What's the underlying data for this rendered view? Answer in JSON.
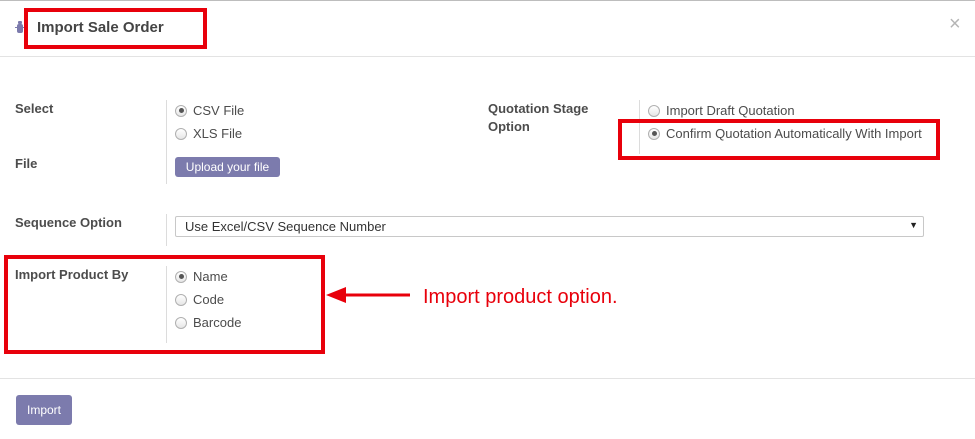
{
  "dialog": {
    "title": "Import Sale Order",
    "close_symbol": "×"
  },
  "form": {
    "select_file": {
      "label_line1": "Select",
      "label_line2": "File",
      "options": [
        {
          "label": "CSV File",
          "checked": true
        },
        {
          "label": "XLS File",
          "checked": false
        }
      ],
      "upload_label": "Upload your file"
    },
    "quotation_stage": {
      "label_line1": "Quotation Stage",
      "label_line2": "Option",
      "options": [
        {
          "label": "Import Draft Quotation",
          "checked": false
        },
        {
          "label": "Confirm Quotation Automatically With Import",
          "checked": true
        }
      ]
    },
    "sequence": {
      "label": "Sequence Option",
      "selected": "Use Excel/CSV Sequence Number",
      "caret": "▼"
    },
    "import_product_by": {
      "label": "Import Product By",
      "options": [
        {
          "label": "Name",
          "checked": true
        },
        {
          "label": "Code",
          "checked": false
        },
        {
          "label": "Barcode",
          "checked": false
        }
      ]
    }
  },
  "annotation": {
    "text": "Import product option.",
    "color": "#e8000b"
  },
  "footer": {
    "import_label": "Import"
  },
  "colors": {
    "primary_button": "#7c7bad",
    "highlight_red": "#e8000b"
  },
  "icons": {
    "header": "bug-icon",
    "close": "close-icon",
    "arrow": "arrow-left-icon"
  }
}
